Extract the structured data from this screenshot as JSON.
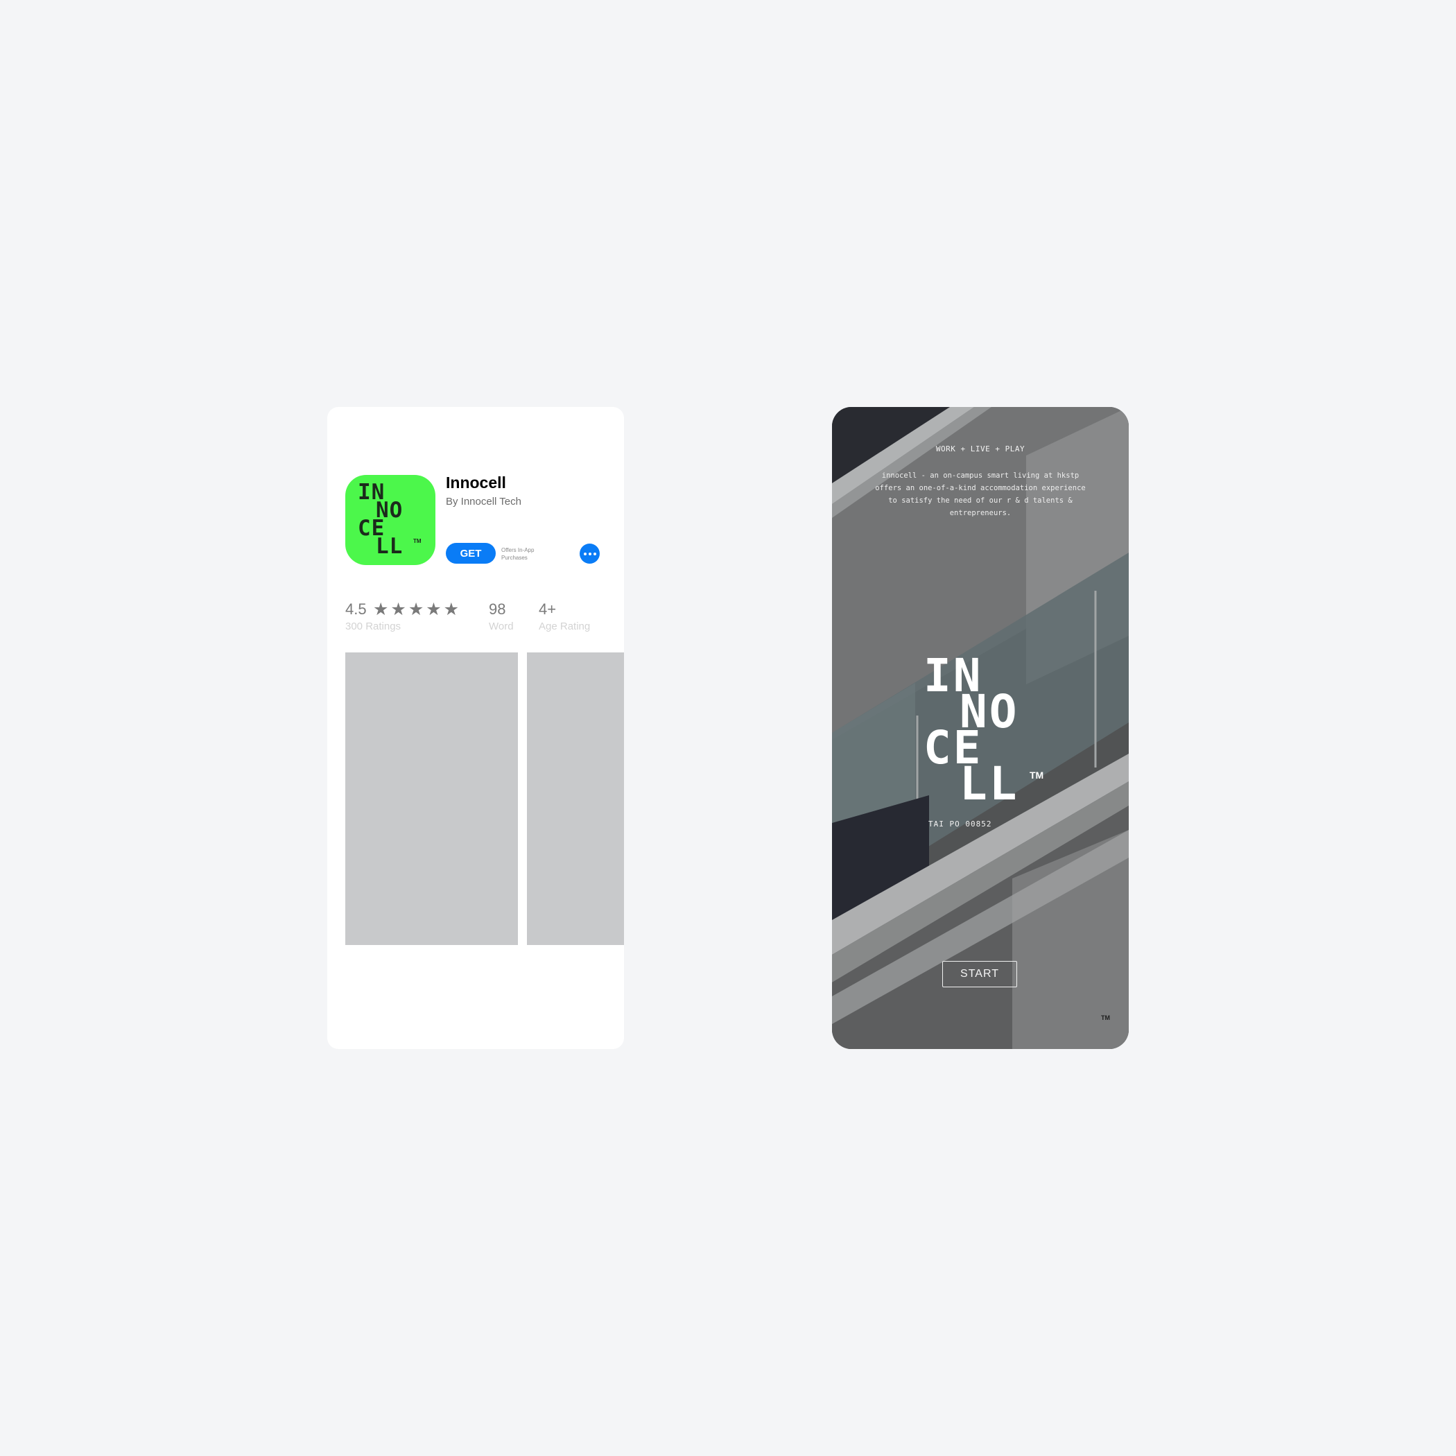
{
  "app_store": {
    "app_name": "Innocell",
    "developer": "By Innocell Tech",
    "icon": {
      "logo_lines": [
        "IN",
        "NO",
        "CE",
        "LL"
      ],
      "trademark": "TM",
      "color": "#4cf74b"
    },
    "get_label": "GET",
    "iap_note": "Offers In-App Purchases",
    "more_icon": "ellipsis-icon",
    "rating": {
      "value": "4.5",
      "stars": "★★★★★",
      "label": "300 Ratings"
    },
    "rank": {
      "value": "98",
      "label": "Word"
    },
    "age": {
      "value": "4+",
      "label": "Age Rating"
    },
    "accent_color": "#0a7cf6"
  },
  "splash": {
    "tagline": "WORK + LIVE + PLAY",
    "blurb": "innocell - an  on-campus  smart living at hkstp offers an one-of-a-kind accommodation experience to satisfy the need of our r & d talents & entrepreneurs.",
    "logo_lines": [
      "IN",
      "NO",
      "CE",
      "LL"
    ],
    "trademark": "TM",
    "postcode": "TAI PO 00852",
    "start_label": "START",
    "corner_mark": "TM"
  }
}
